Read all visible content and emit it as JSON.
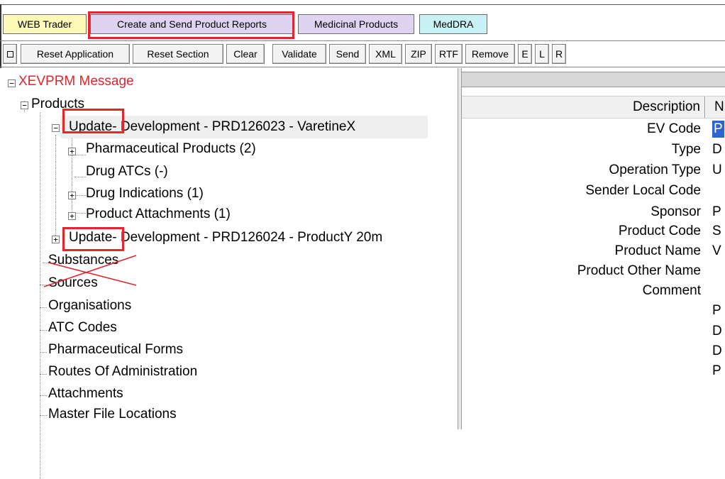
{
  "tabs": [
    {
      "label": "WEB Trader"
    },
    {
      "label": "Create and Send Product Reports"
    },
    {
      "label": "Medicinal Products"
    },
    {
      "label": "MedDRA"
    }
  ],
  "toolbar": {
    "buttons": [
      {
        "label": "Reset Application"
      },
      {
        "label": "Reset Section"
      },
      {
        "label": "Clear"
      },
      {
        "label": "Validate"
      },
      {
        "label": "Send"
      },
      {
        "label": "XML"
      },
      {
        "label": "ZIP"
      },
      {
        "label": "RTF"
      },
      {
        "label": "Remove"
      },
      {
        "label": "E"
      },
      {
        "label": "L"
      },
      {
        "label": "R"
      }
    ]
  },
  "tree": {
    "root": "XEVPRM Message",
    "products": "Products",
    "update1": {
      "op": "Update",
      "rest": " - Development - PRD126023 - VaretineX"
    },
    "children": [
      {
        "label": "Pharmaceutical Products (2)"
      },
      {
        "label": "Drug ATCs (-)"
      },
      {
        "label": "Drug Indications (1)"
      },
      {
        "label": "Product Attachments (1)"
      }
    ],
    "update2": {
      "op": "Update",
      "rest": " - Development - PRD126024 - ProductY 20m"
    },
    "sections": [
      {
        "label": "Substances"
      },
      {
        "label": "Sources"
      },
      {
        "label": "Organisations"
      },
      {
        "label": "ATC Codes"
      },
      {
        "label": "Pharmaceutical Forms"
      },
      {
        "label": "Routes Of Administration"
      },
      {
        "label": "Attachments"
      },
      {
        "label": "Master File Locations"
      }
    ]
  },
  "details": {
    "col_description": "Description",
    "col_n": "N",
    "rows": [
      {
        "label": "EV Code",
        "value": "P"
      },
      {
        "label": "Type",
        "value": "D"
      },
      {
        "label": "Operation Type",
        "value": "U"
      },
      {
        "label": "Sender Local Code",
        "value": ""
      },
      {
        "label": "Sponsor",
        "value": "P"
      },
      {
        "label": "Product Code",
        "value": "S"
      },
      {
        "label": "Product Name",
        "value": "V"
      },
      {
        "label": "Product Other Name",
        "value": ""
      },
      {
        "label": "Comment",
        "value": ""
      }
    ],
    "extra_values": [
      "P",
      "D",
      "D",
      "P"
    ]
  },
  "colors": {
    "highlight": "#e0262f",
    "root_text": "#e0262f",
    "selection": "#2e64d1"
  }
}
